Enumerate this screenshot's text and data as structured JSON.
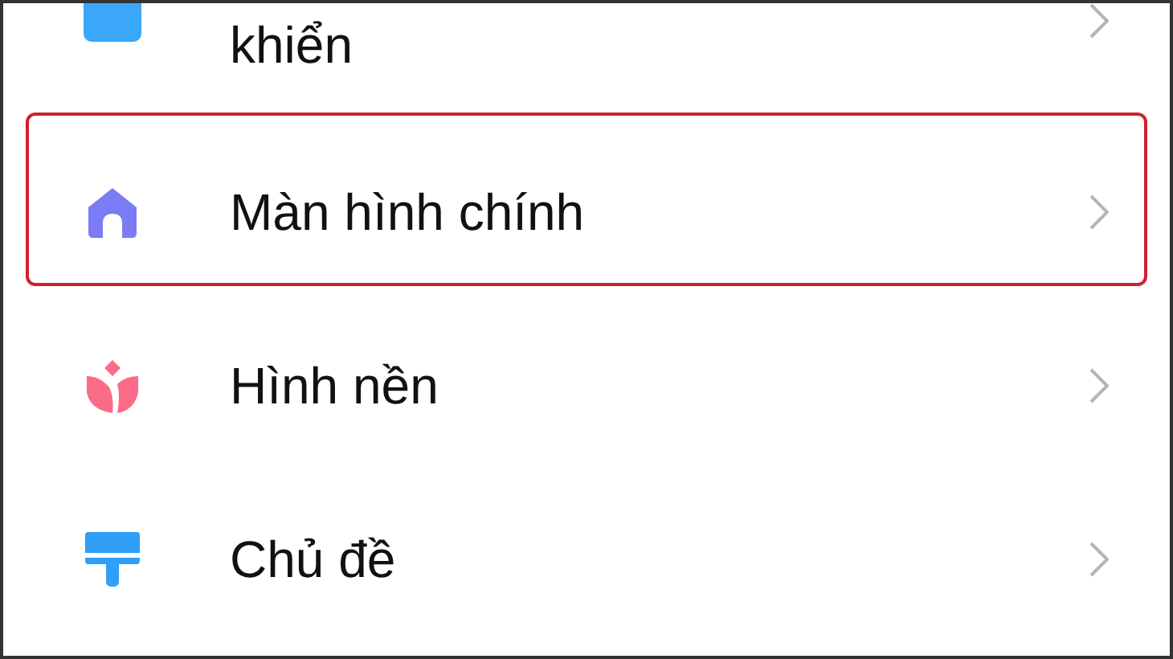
{
  "settings_items": [
    {
      "label": "khiển",
      "color": "#3aa7fb",
      "highlighted": false
    },
    {
      "label": "Màn hình chính",
      "color": "#7b7cf5",
      "highlighted": true
    },
    {
      "label": "Hình nền",
      "color": "#fb6a86",
      "highlighted": false
    },
    {
      "label": "Chủ đề",
      "color": "#2f9ff8",
      "highlighted": false
    }
  ]
}
